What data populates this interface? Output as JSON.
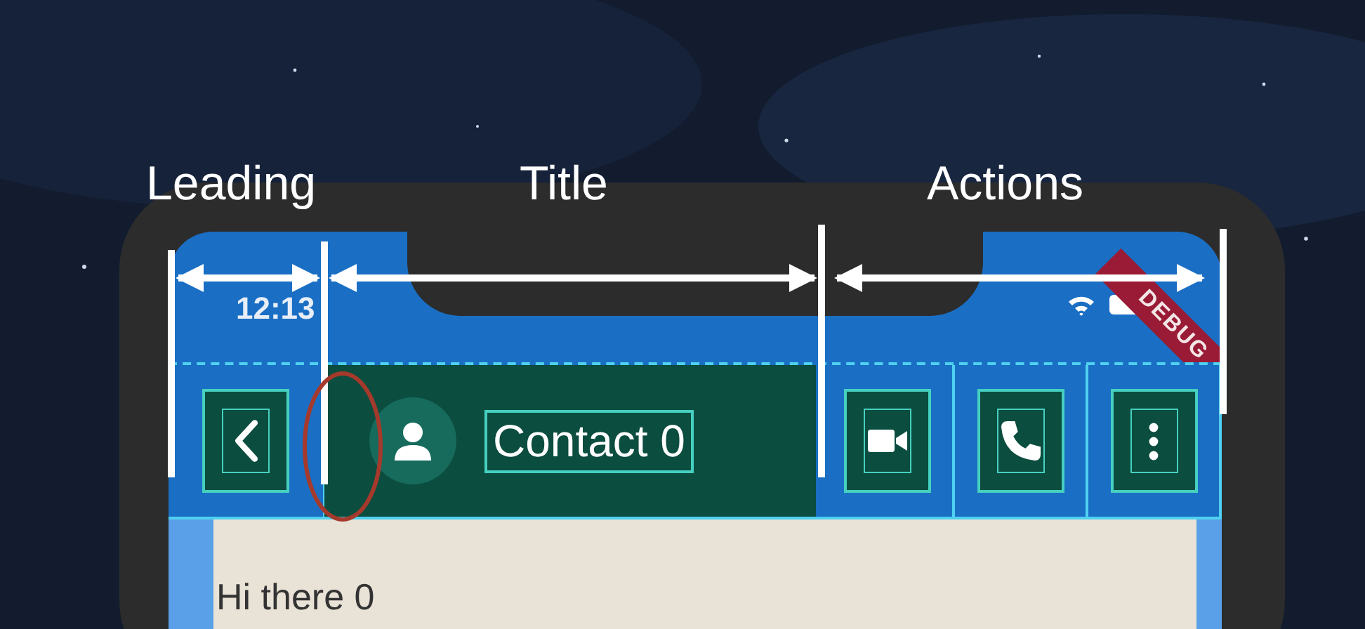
{
  "annotations": [
    {
      "label": "Leading"
    },
    {
      "label": "Title"
    },
    {
      "label": "Actions"
    }
  ],
  "status_bar": {
    "time": "12:13"
  },
  "debug_banner": {
    "label": "DEBUG"
  },
  "app_bar": {
    "title": "Contact 0",
    "actions": [
      {
        "kind": "video"
      },
      {
        "kind": "phone"
      },
      {
        "kind": "more"
      }
    ]
  },
  "messages": [
    {
      "text": "Hi there 0"
    }
  ]
}
